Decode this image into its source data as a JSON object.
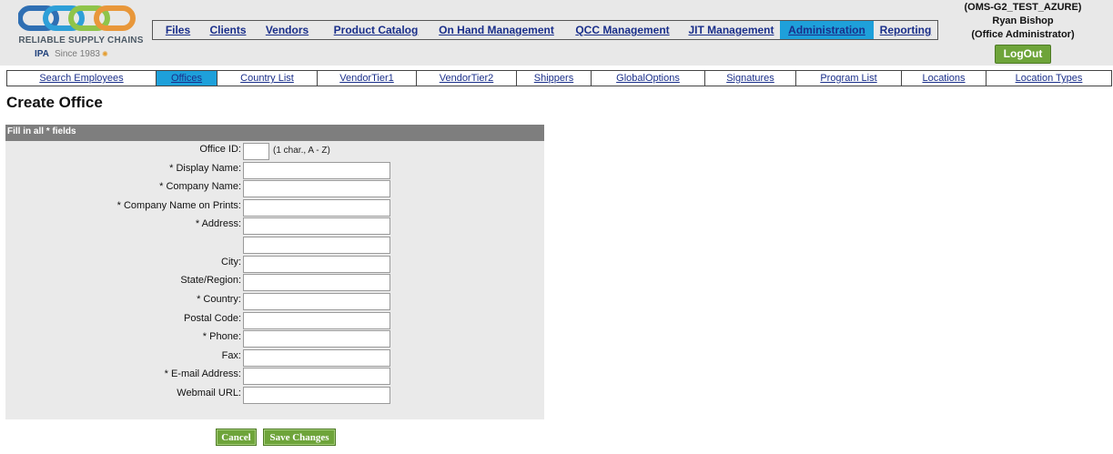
{
  "logo": {
    "name": "RELIABLE SUPPLY CHAINS",
    "partner": "IPA",
    "since": "Since 1983"
  },
  "main_nav": {
    "items": [
      {
        "label": "Files"
      },
      {
        "label": "Clients"
      },
      {
        "label": "Vendors"
      },
      {
        "label": "Product Catalog"
      },
      {
        "label": "On Hand Management"
      },
      {
        "label": "QCC Management"
      },
      {
        "label": "JIT Management"
      },
      {
        "label": "Administration",
        "active": true
      },
      {
        "label": "Reporting"
      }
    ]
  },
  "user": {
    "environment": "(OMS-G2_TEST_AZURE)",
    "name": "Ryan Bishop",
    "role": "(Office Administrator)",
    "logout_label": "LogOut"
  },
  "sub_nav": {
    "items": [
      {
        "label": "Search Employees"
      },
      {
        "label": "Offices",
        "active": true
      },
      {
        "label": "Country List"
      },
      {
        "label": "VendorTier1"
      },
      {
        "label": "VendorTier2"
      },
      {
        "label": "Shippers"
      },
      {
        "label": "GlobalOptions"
      },
      {
        "label": "Signatures"
      },
      {
        "label": "Program List"
      },
      {
        "label": "Locations"
      },
      {
        "label": "Location Types"
      }
    ]
  },
  "page": {
    "title": "Create Office"
  },
  "form": {
    "header": "Fill in all * fields",
    "office_id_hint": "(1 char., A - Z)",
    "fields": [
      {
        "label": "Office ID:",
        "value": ""
      },
      {
        "label": "* Display Name:",
        "value": ""
      },
      {
        "label": "* Company Name:",
        "value": ""
      },
      {
        "label": "* Company Name on Prints:",
        "value": ""
      },
      {
        "label": "* Address:",
        "value": ""
      },
      {
        "label": "",
        "value": ""
      },
      {
        "label": "City:",
        "value": ""
      },
      {
        "label": "State/Region:",
        "value": ""
      },
      {
        "label": "* Country:",
        "value": ""
      },
      {
        "label": "Postal Code:",
        "value": ""
      },
      {
        "label": "* Phone:",
        "value": ""
      },
      {
        "label": "Fax:",
        "value": ""
      },
      {
        "label": "* E-mail Address:",
        "value": ""
      },
      {
        "label": "Webmail URL:",
        "value": ""
      }
    ],
    "cancel_label": "Cancel",
    "save_label": "Save Changes"
  },
  "colors": {
    "active_tab": "#1ea0da",
    "button_green": "#6ea43a",
    "link_blue": "#1a2f8a",
    "form_header": "#7e7e7e",
    "form_bg": "#eaeaea"
  }
}
